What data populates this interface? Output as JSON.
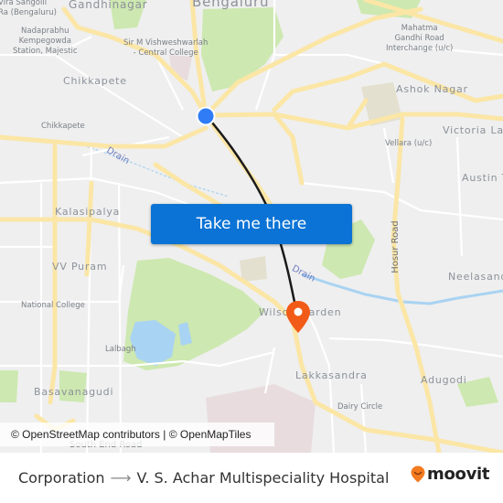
{
  "map": {
    "labels": {
      "city": "Bengaluru",
      "gandhinagar": "Gandhinagar",
      "sangolli": "Vira Sangolli\nRa (Bengaluru)",
      "majestic": "Nadaprabhu\nKempegowda\nStation, Majestic",
      "visvesvaraya": "Sir M Vishweshwarlah\n- Central College",
      "mg_road": "Mahatma\nGandhi Road\nInterchange (u/c)",
      "chikkapete_area": "Chikkapete",
      "chikkapete_poi": "Chikkapete",
      "ashok_nagar": "Ashok Nagar",
      "victoria": "Victoria Lay",
      "vellara": "Vellara (u/c)",
      "austin": "Austin T",
      "drain1": "Drain",
      "drain2": "Drain",
      "kalasipalya": "Kalasipalya",
      "hosur_road": "Hosur Road",
      "vv_puram": "VV Puram",
      "neelasandra": "Neelasand",
      "national_college": "National College",
      "wilson_garden": "Wilson Garden",
      "lalbagh": "Lalbagh",
      "lakkasandra": "Lakkasandra",
      "adugodi": "Adugodi",
      "basavanagudi": "Basavanagudi",
      "dairy_circle": "Dairy Circle",
      "south_end_road": "South End Road"
    },
    "origin_marker": "origin-dot",
    "destination_marker": "destination-pin",
    "colors": {
      "background": "#efefef",
      "major_road": "#fbe6a6",
      "minor_road": "#ffffff",
      "park": "#cde8b0",
      "water": "#a9d3f2",
      "route": "#1a1a1a",
      "origin": "#2f7cf6",
      "destination": "#f25a17"
    }
  },
  "cta": {
    "label": "Take me there",
    "color": "#0a73d5"
  },
  "attribution": {
    "osm": "© OpenStreetMap contributors",
    "separator": " | ",
    "tiles": "© OpenMapTiles"
  },
  "footer": {
    "origin": "Corporation",
    "arrow": "⟶",
    "destination": "V. S. Achar Multispeciality Hospital",
    "brand": "moovit",
    "brand_color": "#f47a20"
  }
}
